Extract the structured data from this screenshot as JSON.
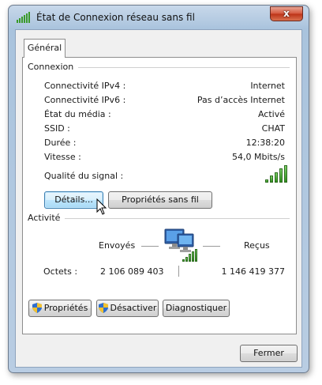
{
  "window": {
    "title": "État de Connexion réseau sans fil",
    "close_label": "x"
  },
  "tabs": [
    {
      "label": "Général"
    }
  ],
  "connexion": {
    "heading": "Connexion",
    "rows": [
      {
        "label": "Connectivité IPv4 :",
        "value": "Internet"
      },
      {
        "label": "Connectivité IPv6 :",
        "value": "Pas d’accès Internet"
      },
      {
        "label": "État du média :",
        "value": "Activé"
      },
      {
        "label": "SSID :",
        "value": "CHAT"
      },
      {
        "label": "Durée :",
        "value": "12:38:20"
      },
      {
        "label": "Vitesse :",
        "value": "54,0 Mbits/s"
      }
    ],
    "signal_label": "Qualité du signal :",
    "signal_bars": 5,
    "signal_bars_max": 5
  },
  "buttons": {
    "details": "Détails...",
    "wireless_props": "Propriétés sans fil",
    "properties": "Propriétés",
    "disable": "Désactiver",
    "diagnose": "Diagnostiquer",
    "close": "Fermer"
  },
  "activite": {
    "heading": "Activité",
    "sent_label": "Envoyés",
    "received_label": "Reçus",
    "bytes_label": "Octets :",
    "bytes_sent": "2 106 089 403",
    "bytes_received": "1 146 419 377"
  },
  "colors": {
    "accent": "#3c7fb1",
    "signal_green": "#2f8f1c",
    "close_red": "#c63c1f"
  }
}
